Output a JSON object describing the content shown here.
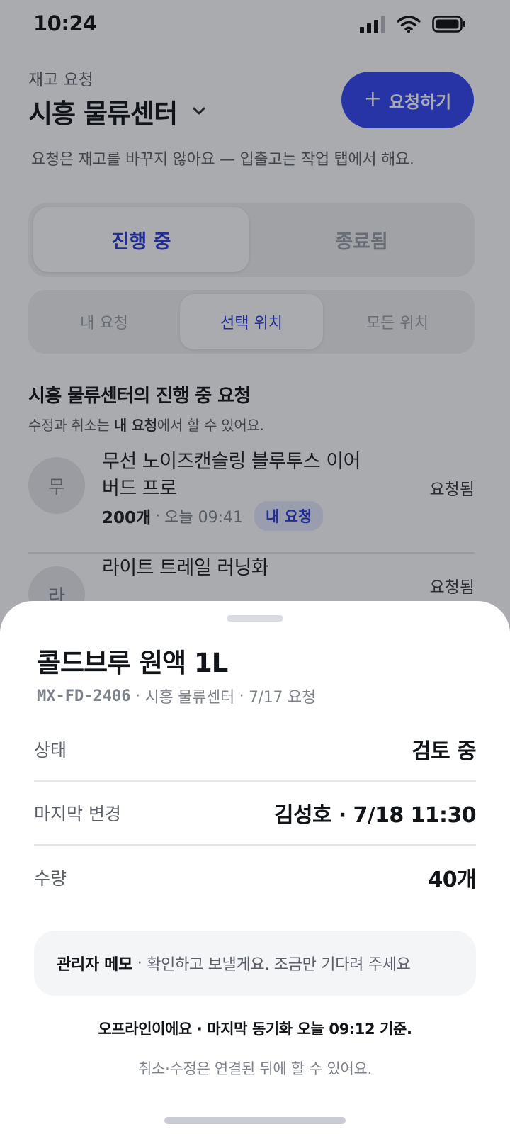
{
  "status_bar": {
    "time": "10:24",
    "icons": [
      "signal-icon",
      "wifi-icon",
      "battery-icon"
    ]
  },
  "header": {
    "eyebrow": "재고 요청",
    "location": "시흥 물류센터",
    "new_request_button": "요청하기",
    "subtitle": "요청은 재고를 바꾸지 않아요 — 입출고는 작업 탭에서 해요."
  },
  "status_tabs": {
    "items": [
      "진행 중",
      "종료됨"
    ],
    "selected": "진행 중"
  },
  "scope_tabs": {
    "items": [
      "내 요청",
      "선택 위치",
      "모든 위치"
    ],
    "selected": "선택 위치"
  },
  "section": {
    "title": "시흥 물류센터의 진행 중 요청",
    "note_prefix": "수정과 취소는 ",
    "note_bold": "내 요청",
    "note_suffix": "에서 할 수 있어요."
  },
  "requests": [
    {
      "avatar": "무",
      "name": "무선 노이즈캔슬링 블루투스 이어버드 프로",
      "quantity": "200개",
      "time": "오늘 09:41",
      "badge": "내 요청",
      "status": "요청됨"
    },
    {
      "avatar": "라",
      "name": "라이트 트레일 러닝화",
      "status": "요청됨"
    }
  ],
  "sheet": {
    "title": "콜드브루 원액 1L",
    "sku": "MX-FD-2406",
    "location": "시흥 물류센터",
    "requested": "7/17 요청",
    "fields": [
      {
        "label": "상태",
        "value": "검토 중"
      },
      {
        "label": "마지막 변경",
        "value": "김성호 · 7/18 11:30"
      },
      {
        "label": "수량",
        "value": "40개"
      }
    ],
    "memo_label": "관리자 메모",
    "memo_text": "확인하고 보낼게요. 조금만 기다려 주세요",
    "offline_text": "오프라인이에요 · 마지막 동기화 오늘 09:12 기준.",
    "offline_note": "취소·수정은 연결된 뒤에 할 수 있어요."
  },
  "colors": {
    "accent": "#3346f2",
    "accent_text": "#2b3bd6",
    "badge_bg": "#e5e9ff",
    "scrim": "rgba(20,22,30,0.36)"
  }
}
